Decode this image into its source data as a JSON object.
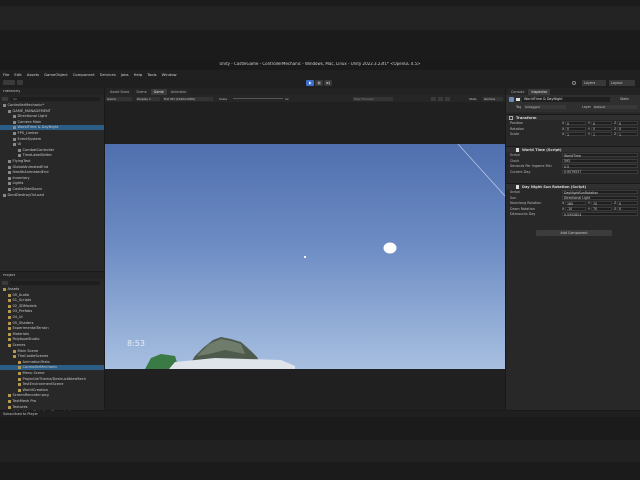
{
  "window": {
    "title": "Unity - CastleGame - ControllerMechanic - Windows, Mac, Linux - Unity 2022.3.23f1* <OpenGL 4.5>"
  },
  "menubar": [
    "File",
    "Edit",
    "Assets",
    "GameObject",
    "Component",
    "Services",
    "Jobs",
    "Help",
    "Tools",
    "Window"
  ],
  "toolbar": {
    "layers": "Layers",
    "layout": "Layout"
  },
  "hierarchy": {
    "tab": "Hierarchy",
    "search_placeholder": "All",
    "items": [
      {
        "label": "ControllerMechanic*",
        "indent": 0
      },
      {
        "label": "GAME_MANAGEMENT",
        "indent": 1
      },
      {
        "label": "Directional Light",
        "indent": 2
      },
      {
        "label": "Camera Main",
        "indent": 2
      },
      {
        "label": "WorldTime & DayNight",
        "indent": 2
      },
      {
        "label": "FPS_Limiter",
        "indent": 2
      },
      {
        "label": "EventSystem",
        "indent": 2
      },
      {
        "label": "UI",
        "indent": 2
      },
      {
        "label": "CombatController",
        "indent": 3
      },
      {
        "label": "TimeLabelSetter",
        "indent": 3
      },
      {
        "label": "FlyingText",
        "indent": 1
      },
      {
        "label": "GlobalAnimatedEnd",
        "indent": 1
      },
      {
        "label": "HealthAnimatedEnd",
        "indent": 1
      },
      {
        "label": "Inventory",
        "indent": 1
      },
      {
        "label": "Lights",
        "indent": 1
      },
      {
        "label": "CastleSideDoors",
        "indent": 1
      },
      {
        "label": "DontDestroyOnLoad",
        "indent": 0
      }
    ]
  },
  "scene_tabs": [
    "Asset Store",
    "Scene",
    "Game",
    "Animator"
  ],
  "game_toolbar": {
    "display": "Game",
    "display_num": "Display 1",
    "aspect": "Full HD (1920x1080)",
    "scale_label": "Scale",
    "scale_value": "1x",
    "play_mode": "Play Focused",
    "stats": "Stats",
    "gizmos": "Gizmos"
  },
  "game_view": {
    "time_label": "8:53"
  },
  "project": {
    "tab": "Project",
    "items": [
      {
        "label": "Assets",
        "indent": 0
      },
      {
        "label": "00_Audio",
        "indent": 1
      },
      {
        "label": "01_Scripts",
        "indent": 1
      },
      {
        "label": "02_3DModels",
        "indent": 1
      },
      {
        "label": "03_Prefabs",
        "indent": 1
      },
      {
        "label": "04_UI",
        "indent": 1
      },
      {
        "label": "05_Shaders",
        "indent": 1
      },
      {
        "label": "ExperimentalTerrain",
        "indent": 1
      },
      {
        "label": "Materials",
        "indent": 1
      },
      {
        "label": "PolytopeStudio",
        "indent": 1
      },
      {
        "label": "Scenes",
        "indent": 1
      },
      {
        "label": "Main Scene",
        "indent": 2
      },
      {
        "label": "TheCastleScenes",
        "indent": 2
      },
      {
        "label": "AnimationTests",
        "indent": 3
      },
      {
        "label": "ControllerMechanic",
        "indent": 3
      },
      {
        "label": "Menu Scene",
        "indent": 3
      },
      {
        "label": "ProjectileTheme/DestructiblesMech",
        "indent": 3
      },
      {
        "label": "TestEnvironmentScene",
        "indent": 3
      },
      {
        "label": "WorldCreation",
        "indent": 3
      },
      {
        "label": "ScreenRecorder.png",
        "indent": 1
      },
      {
        "label": "TextMesh Pro",
        "indent": 1
      },
      {
        "label": "Textures",
        "indent": 1
      },
      {
        "label": "Unity-VisualScripting-Generated",
        "indent": 1
      }
    ]
  },
  "inspector": {
    "tabs": [
      "Console",
      "Inspector"
    ],
    "object_name": "WorldTime & DayNight",
    "static_label": "Static",
    "tag_label": "Tag",
    "tag_value": "Untagged",
    "layer_label": "Layer",
    "layer_value": "Default",
    "transform": {
      "title": "Transform",
      "rows": [
        {
          "label": "Position",
          "x": "0",
          "y": "0",
          "z": "0"
        },
        {
          "label": "Rotation",
          "x": "0",
          "y": "0",
          "z": "0"
        },
        {
          "label": "Scale",
          "x": "1",
          "y": "1",
          "z": "1"
        }
      ]
    },
    "world_time": {
      "title": "World Time (Script)",
      "rows": [
        {
          "label": "Script",
          "value": "WorldTime"
        },
        {
          "label": "Clock",
          "value": "593"
        },
        {
          "label": "Seconds Per Ingame Min",
          "value": "0.5"
        },
        {
          "label": "Current Day",
          "value": "0.9579537"
        }
      ]
    },
    "day_night": {
      "title": "Day Night Sun Rotation (Script)",
      "rows": [
        {
          "label": "Script",
          "value": "DayNightSunRotation"
        },
        {
          "label": "Sun",
          "value": "Directional Light"
        },
        {
          "label": "Noonlong Rotation",
          "x": "180",
          "y": "70",
          "z": "0"
        },
        {
          "label": "Dawn Rotation",
          "x": "-10",
          "y": "70",
          "z": "0"
        },
        {
          "label": "DAmounts Day",
          "value": "0.5552824"
        }
      ]
    },
    "add_component": "Add Component"
  },
  "console": {
    "status": "Subscribed to Player"
  },
  "colors": {
    "sky_top": "#4f6fae",
    "sky_bottom": "#a7bfe0",
    "play_blue": "#3d6ec9",
    "selection": "#2c5d87"
  }
}
